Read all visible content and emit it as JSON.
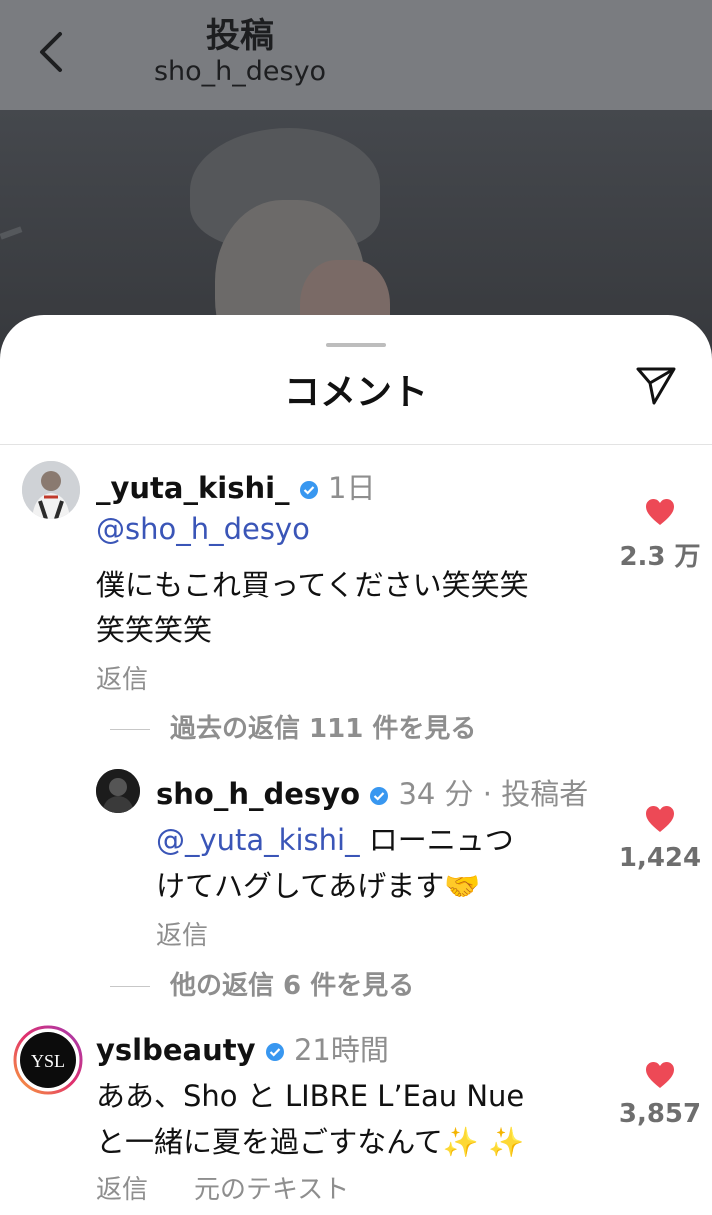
{
  "header": {
    "title": "投稿",
    "username": "sho_h_desyo"
  },
  "sheet": {
    "title": "コメント"
  },
  "comments": [
    {
      "username": "_yuta_kishi_",
      "time": "1日",
      "mention": "@sho_h_desyo",
      "text_line1": "僕にもこれ買ってください笑笑笑",
      "text_line2": "笑笑笑笑",
      "reply_label": "返信",
      "likes": "2.3 万",
      "view_replies": "過去の返信 111 件を見る"
    },
    {
      "username": "sho_h_desyo",
      "time": "34 分 · 投稿者",
      "mention": "@_yuta_kishi_",
      "text_line1_rest": " ローニュつ",
      "text_line2": "けてハグしてあげます🤝",
      "reply_label": "返信",
      "likes": "1,424",
      "view_replies": "他の返信 6 件を見る"
    },
    {
      "username": "yslbeauty",
      "time": "21時間",
      "text_line1": "ああ、Sho と LIBRE L’Eau Nue",
      "text_line2": "と一緒に夏を過ごすなんて✨ ✨",
      "reply_label": "返信",
      "translate_label": "元のテキスト",
      "likes": "3,857"
    }
  ],
  "colors": {
    "header_dim": "#7a7c80",
    "mention": "#3a55b7",
    "like_heart": "#ed4956",
    "verified_badge": "#3897f0",
    "meta_gray": "#8e8e8e"
  },
  "icons": [
    "back-chevron-icon",
    "send-icon",
    "heart-icon",
    "verified-badge-icon",
    "ysl-logo"
  ]
}
